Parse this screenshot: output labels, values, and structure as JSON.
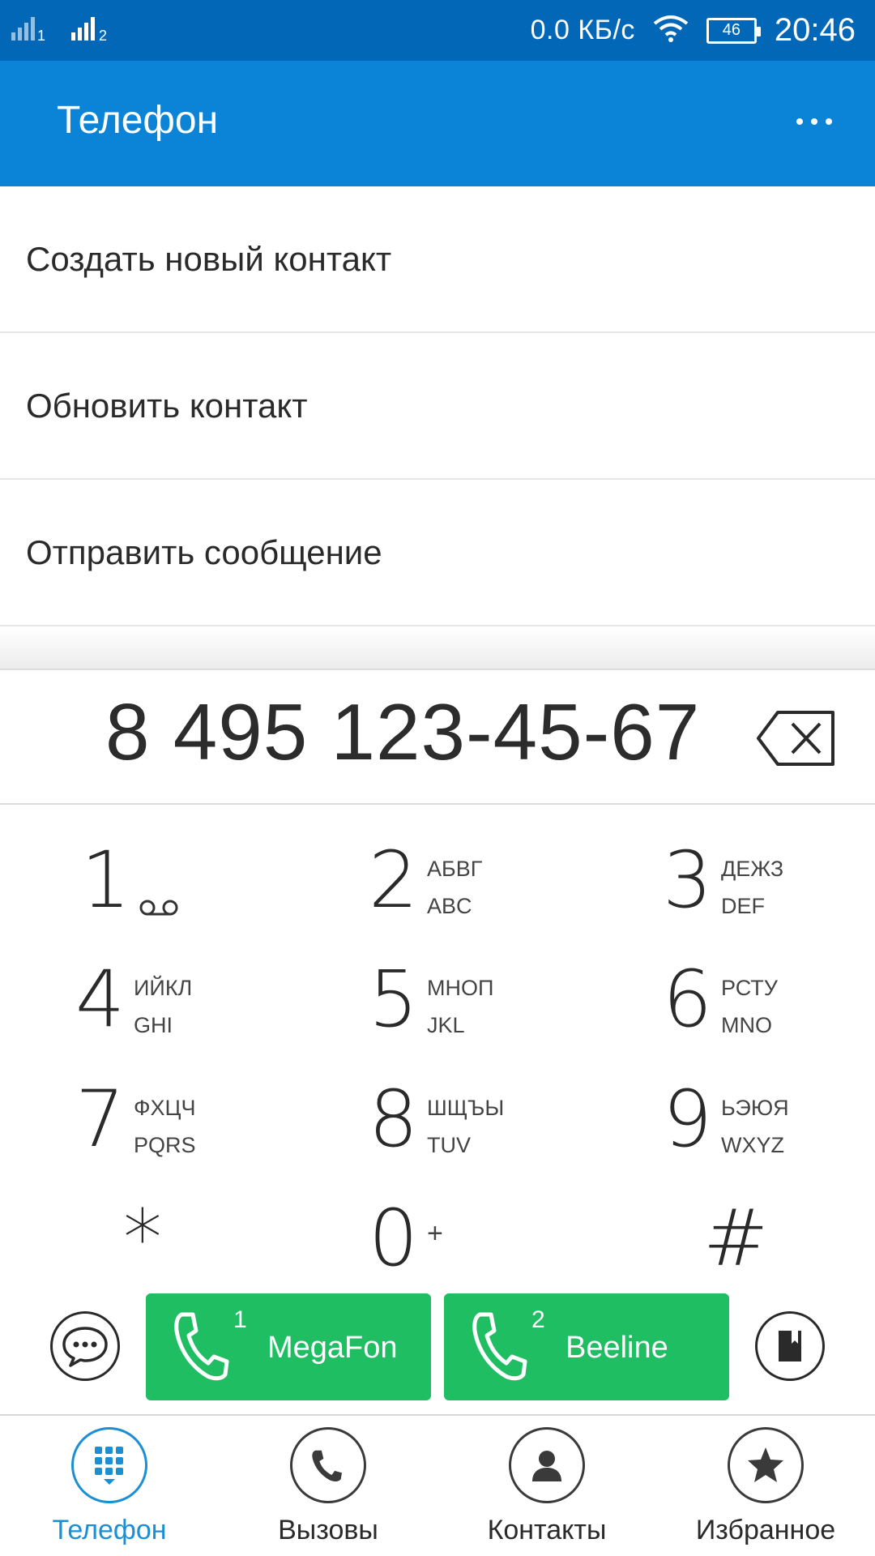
{
  "status_bar": {
    "sim1_label": "1",
    "sim2_label": "2",
    "data_speed": "0.0 КБ/с",
    "battery": "46",
    "time": "20:46"
  },
  "app_bar": {
    "title": "Телефон"
  },
  "options": [
    {
      "label": "Создать новый контакт"
    },
    {
      "label": "Обновить контакт"
    },
    {
      "label": "Отправить сообщение"
    }
  ],
  "dialer": {
    "number": "8 495 123-45-67"
  },
  "keys": [
    {
      "digit": "1",
      "top": "",
      "bottom": ""
    },
    {
      "digit": "2",
      "top": "АБВГ",
      "bottom": "ABC"
    },
    {
      "digit": "3",
      "top": "ДЕЖЗ",
      "bottom": "DEF"
    },
    {
      "digit": "4",
      "top": "ИЙКЛ",
      "bottom": "GHI"
    },
    {
      "digit": "5",
      "top": "МНОП",
      "bottom": "JKL"
    },
    {
      "digit": "6",
      "top": "РСТУ",
      "bottom": "MNO"
    },
    {
      "digit": "7",
      "top": "ФХЦЧ",
      "bottom": "PQRS"
    },
    {
      "digit": "8",
      "top": "ШЩЪЫ",
      "bottom": "TUV"
    },
    {
      "digit": "9",
      "top": "ЬЭЮЯ",
      "bottom": "WXYZ"
    },
    {
      "digit": "*",
      "top": "",
      "bottom": ""
    },
    {
      "digit": "0",
      "top": "+",
      "bottom": ""
    },
    {
      "digit": "#",
      "top": "",
      "bottom": ""
    }
  ],
  "call_buttons": [
    {
      "sim": "1",
      "carrier": "MegaFon"
    },
    {
      "sim": "2",
      "carrier": "Beeline"
    }
  ],
  "bottom_nav": [
    {
      "label": "Телефон",
      "icon": "dialpad-icon",
      "active": true
    },
    {
      "label": "Вызовы",
      "icon": "phone-icon",
      "active": false
    },
    {
      "label": "Контакты",
      "icon": "person-icon",
      "active": false
    },
    {
      "label": "Избранное",
      "icon": "star-icon",
      "active": false
    }
  ],
  "colors": {
    "status_bar": "#0367b8",
    "app_bar": "#0b84d8",
    "call_green": "#1fbe62",
    "active_nav": "#1b8fd4"
  }
}
